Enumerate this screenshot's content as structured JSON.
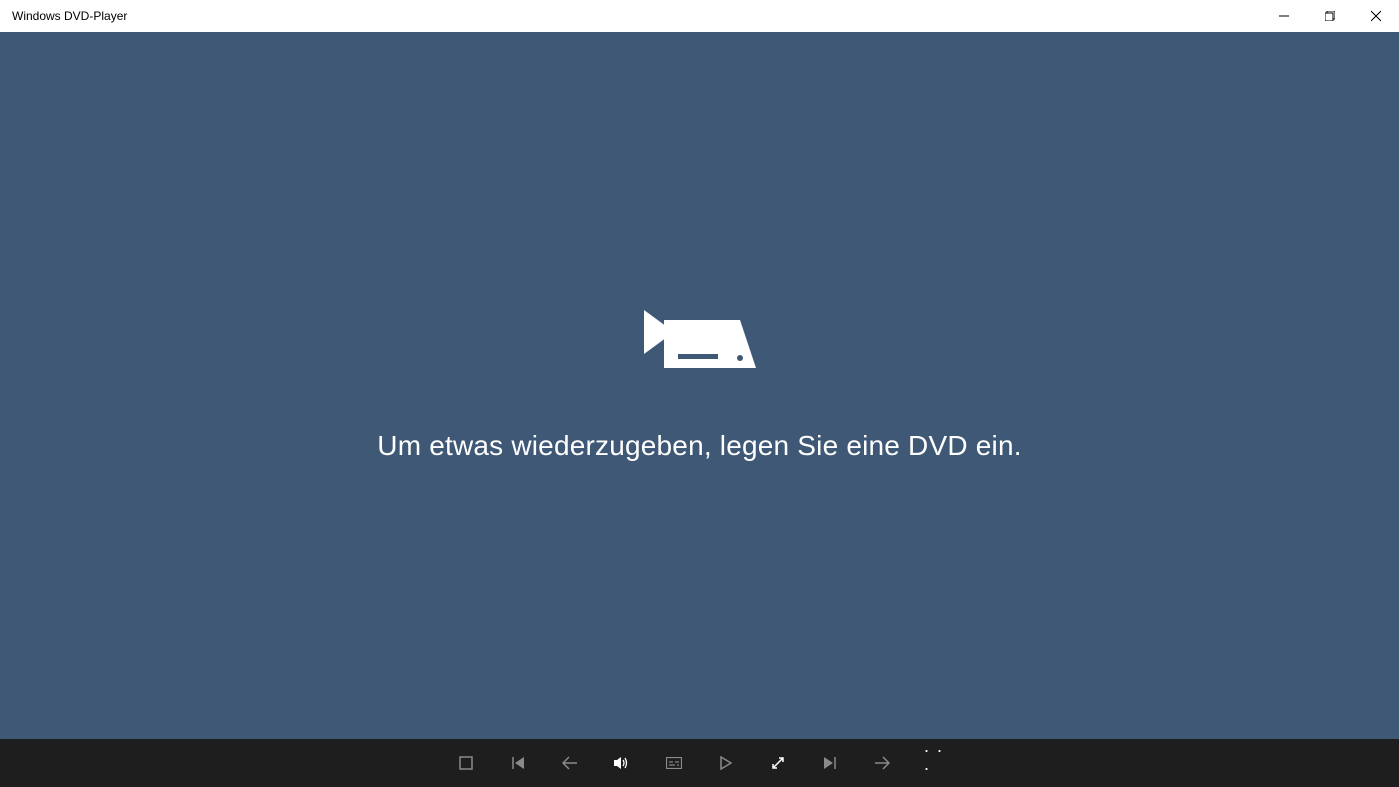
{
  "window": {
    "title": "Windows DVD-Player"
  },
  "content": {
    "message": "Um etwas wiederzugeben, legen Sie eine DVD ein."
  },
  "colors": {
    "background": "#3f5876",
    "playbar": "#1e1e1e",
    "inactive_icon": "#8a8a8a",
    "active_icon": "#ffffff"
  },
  "controls": {
    "stop": "stop",
    "previous": "previous",
    "back": "back",
    "volume": "volume",
    "subtitles": "subtitles",
    "play": "play",
    "fullscreen": "fullscreen",
    "next_track": "next-track",
    "forward": "forward",
    "more": "more"
  }
}
